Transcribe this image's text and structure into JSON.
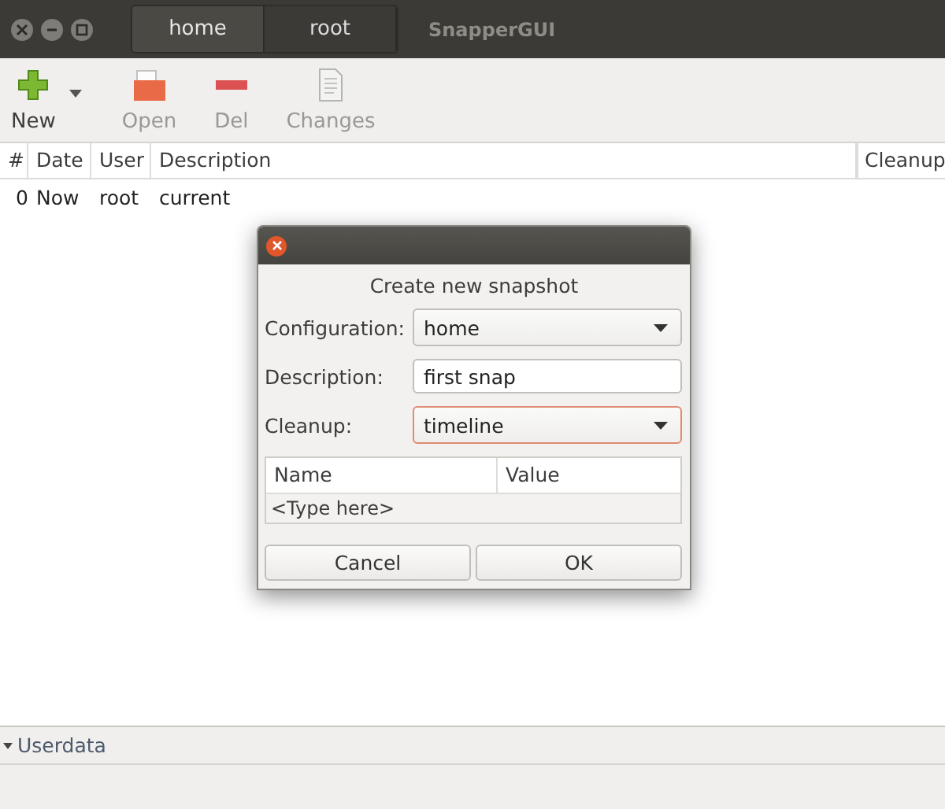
{
  "window": {
    "title": "SnapperGUI"
  },
  "tabs": [
    {
      "label": "home",
      "selected": true
    },
    {
      "label": "root",
      "selected": false
    }
  ],
  "toolbar": [
    {
      "label": "New",
      "kind": "new",
      "disabled": false
    },
    {
      "label": "Open",
      "kind": "open",
      "disabled": true
    },
    {
      "label": "Del",
      "kind": "del",
      "disabled": true
    },
    {
      "label": "Changes",
      "kind": "changes",
      "disabled": true
    }
  ],
  "table": {
    "columns": [
      "#",
      "Date",
      "User",
      "Description",
      "Cleanup"
    ],
    "rows": [
      [
        "0",
        "Now",
        "root",
        "current",
        ""
      ]
    ]
  },
  "dialog": {
    "title": "Create new snapshot",
    "fields": [
      {
        "label": "Configuration:",
        "kind": "combo",
        "value": "home",
        "focused": false
      },
      {
        "label": "Description:",
        "kind": "entry",
        "value": "first snap",
        "focused": false
      },
      {
        "label": "Cleanup:",
        "kind": "combo",
        "value": "timeline",
        "focused": true
      }
    ],
    "userdata": {
      "columns": [
        "Name",
        "Value"
      ],
      "placeholder": "<Type here>"
    },
    "buttons": [
      "Cancel",
      "OK"
    ]
  },
  "userdata_expander": {
    "label": "Userdata"
  }
}
